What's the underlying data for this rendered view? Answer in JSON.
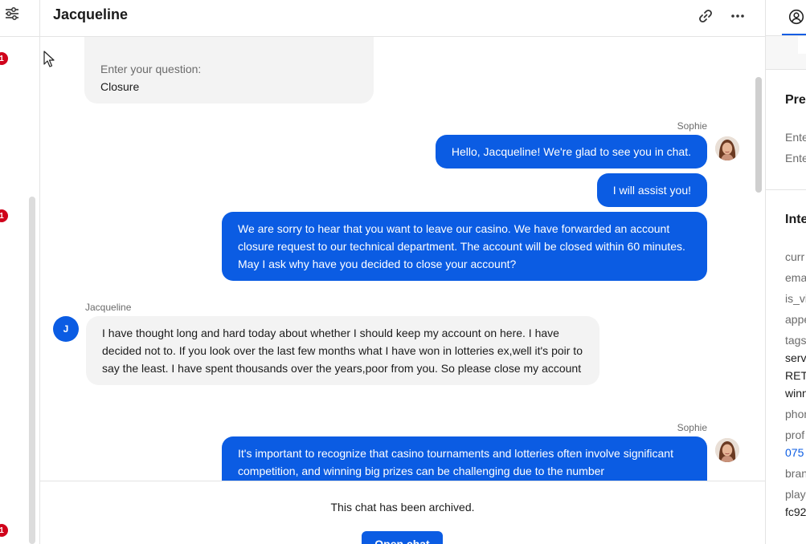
{
  "header": {
    "title": "Jacqueline"
  },
  "sidebar": {
    "badges": [
      "1",
      "1",
      "1"
    ]
  },
  "messages": {
    "prechat_question_label": "Enter your question:",
    "prechat_question_value": "Closure",
    "agent_name": "Sophie",
    "agent_name_2": "Sophie",
    "agent_msg_1": "Hello, Jacqueline! We're glad to see you in chat.",
    "agent_msg_2": "I will assist you!",
    "agent_msg_3": "We are sorry to hear that you want to leave our casino. We have forwarded an account closure request to our technical department. The account will be closed within 60 minutes. May I ask why have you decided to close your account?",
    "customer_name": "Jacqueline",
    "customer_initial": "J",
    "customer_msg": "I have thought long and hard today about whether I should keep my account on here. I have decided not to. If you look over the last few months what I have won in lotteries ex,well it's poir to say the least. I have spent thousands over the years,poor from you. So please close my account",
    "agent_msg_4": "It's important to recognize that casino tournaments and lotteries often involve significant competition, and winning big prizes can be challenging due to the number"
  },
  "footer": {
    "archived_text": "This chat has been archived.",
    "open_chat_label": "Open chat"
  },
  "right_panel": {
    "section_prechat_heading": "Pre",
    "prechat_label_1": "Ente",
    "prechat_label_2": "Ente",
    "section_integration_heading": "Inte",
    "fields": [
      {
        "label": "curr",
        "value": ""
      },
      {
        "label": "ema",
        "value": ""
      },
      {
        "label": "is_vi",
        "value": ""
      },
      {
        "label": "appe",
        "value": ""
      },
      {
        "label": "tags",
        "value": "serv"
      },
      {
        "label": "",
        "value": "RET"
      },
      {
        "label": "",
        "value": "winn"
      },
      {
        "label": "phon",
        "value": ""
      },
      {
        "label": "prof",
        "value": "075"
      },
      {
        "label": "bran",
        "value": ""
      },
      {
        "label": "play",
        "value": "fc92"
      }
    ]
  },
  "colors": {
    "accent": "#0b5ce3",
    "badge": "#d0021b",
    "incoming_bubble": "#f3f3f3"
  }
}
